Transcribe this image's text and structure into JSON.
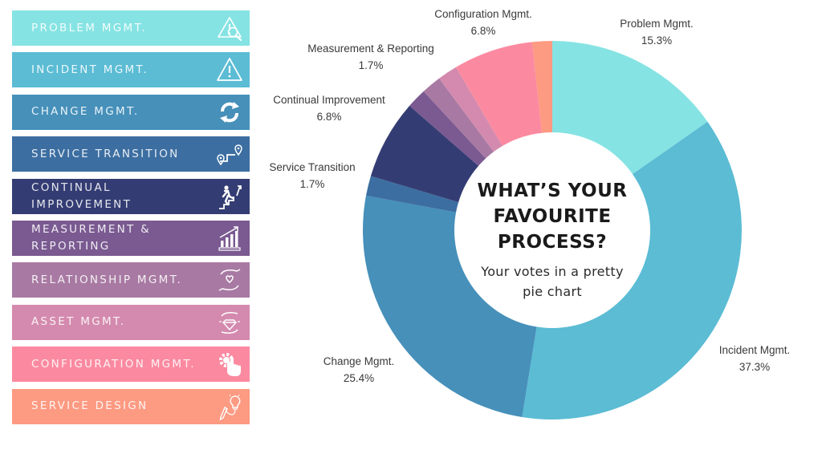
{
  "legend": {
    "items": [
      {
        "label": "PROBLEM MGMT.",
        "color": "#86e3e3",
        "icon": "warning-magnifier-icon"
      },
      {
        "label": "INCIDENT MGMT.",
        "color": "#5bbcd4",
        "icon": "warning-triangle-icon"
      },
      {
        "label": "CHANGE MGMT.",
        "color": "#4690ba",
        "icon": "refresh-arrows-icon"
      },
      {
        "label": "SERVICE TRANSITION",
        "color": "#3c6ea1",
        "icon": "route-pins-icon"
      },
      {
        "label": "CONTINUAL\nIMPROVEMENT",
        "color": "#343d73",
        "icon": "climbing-stairs-icon"
      },
      {
        "label": "MEASUREMENT &\nREPORTING",
        "color": "#7a5a91",
        "icon": "growth-chart-icon"
      },
      {
        "label": "RELATIONSHIP MGMT.",
        "color": "#a87aa3",
        "icon": "hands-heart-icon"
      },
      {
        "label": "ASSET MGMT.",
        "color": "#d48aae",
        "icon": "hands-diamond-icon"
      },
      {
        "label": "CONFIGURATION MGMT.",
        "color": "#fb8aa0",
        "icon": "gear-hand-icon"
      },
      {
        "label": "SERVICE DESIGN",
        "color": "#fd9a82",
        "icon": "pencil-bulb-icon"
      }
    ]
  },
  "chart_data": {
    "type": "pie",
    "variant": "donut",
    "title": "WHAT’S YOUR FAVOURITE PROCESS?",
    "title_lines": [
      "WHAT’S YOUR",
      "FAVOURITE",
      "PROCESS?"
    ],
    "subtitle": "Your votes in a pretty pie chart",
    "subtitle_lines": [
      "Your votes in a pretty",
      "pie chart"
    ],
    "start": "12 o'clock",
    "direction": "clockwise",
    "unit": "%",
    "slices": [
      {
        "name": "Problem Mgmt.",
        "value": 15.3,
        "label": "15.3%",
        "color": "#86e3e3",
        "labeled": true
      },
      {
        "name": "Incident Mgmt.",
        "value": 37.3,
        "label": "37.3%",
        "color": "#5bbcd4",
        "labeled": true
      },
      {
        "name": "Change Mgmt.",
        "value": 25.4,
        "label": "25.4%",
        "color": "#4690ba",
        "labeled": true
      },
      {
        "name": "Service Transition",
        "value": 1.7,
        "label": "1.7%",
        "color": "#3c6ea1",
        "labeled": true
      },
      {
        "name": "Continual Improvement",
        "value": 6.8,
        "label": "6.8%",
        "color": "#343d73",
        "labeled": true
      },
      {
        "name": "Measurement & Reporting",
        "value": 1.7,
        "label": "1.7%",
        "color": "#7a5a91",
        "labeled": true
      },
      {
        "name": "Relationship Mgmt.",
        "value": 1.7,
        "label": "",
        "color": "#a87aa3",
        "labeled": false
      },
      {
        "name": "Asset Mgmt.",
        "value": 1.7,
        "label": "",
        "color": "#d48aae",
        "labeled": false
      },
      {
        "name": "Configuration Mgmt.",
        "value": 6.8,
        "label": "6.8%",
        "color": "#fb8aa0",
        "labeled": true
      },
      {
        "name": "Service Design",
        "value": 1.7,
        "label": "",
        "color": "#fd9a82",
        "labeled": false
      }
    ]
  }
}
